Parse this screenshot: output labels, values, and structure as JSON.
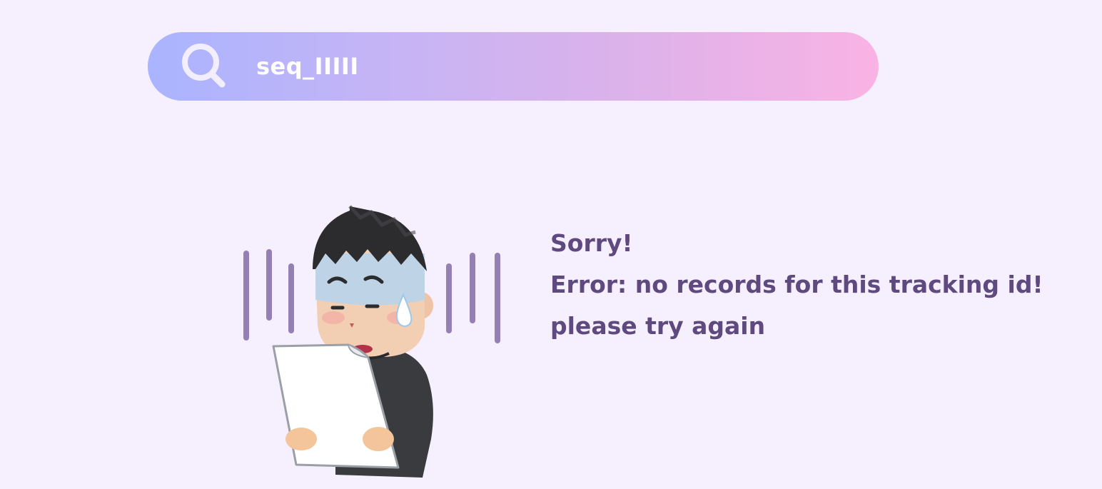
{
  "search": {
    "value": "seq_IIIII",
    "icon": "search-icon"
  },
  "illustration": {
    "icon": "worried-person-reading-paper-illustration"
  },
  "message": {
    "line1": "Sorry!",
    "line2": "Error: no records for this tracking id!",
    "line3": "please try again"
  },
  "colors": {
    "background": "#f6effd",
    "gradient_start": "#aab4ff",
    "gradient_end": "#f9b3e4",
    "message_text": "#5e4a7e",
    "shake_lines": "#8b74ad"
  }
}
